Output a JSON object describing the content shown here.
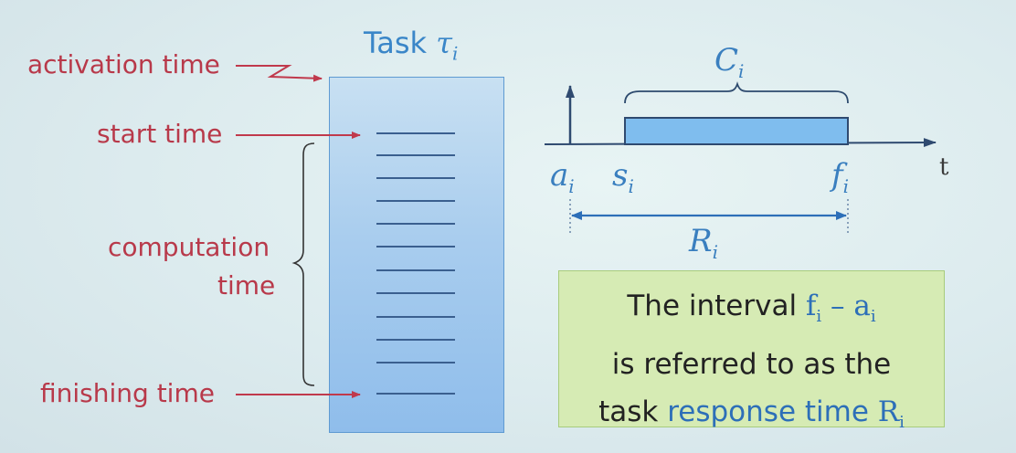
{
  "labels": {
    "activation": "activation time",
    "start": "start time",
    "computation_line1": "computation",
    "computation_line2": "time",
    "finishing": "finishing time"
  },
  "task": {
    "title_word": "Task",
    "symbol": "τ",
    "subscript": "i"
  },
  "timeline": {
    "axis_label": "t",
    "a": {
      "symbol": "a",
      "subscript": "i"
    },
    "s": {
      "symbol": "s",
      "subscript": "i"
    },
    "f": {
      "symbol": "f",
      "subscript": "i"
    },
    "C": {
      "symbol": "C",
      "subscript": "i"
    },
    "R": {
      "symbol": "R",
      "subscript": "i"
    }
  },
  "note": {
    "line1_prefix": "The interval ",
    "f_symbol": "f",
    "f_sub": "i",
    "minus": " – ",
    "a_symbol": "a",
    "a_sub": "i",
    "line2": "is referred to as the",
    "line3_prefix": "task ",
    "line3_blue": "response time ",
    "R_symbol": "R",
    "R_sub": "i"
  },
  "colors": {
    "label_red": "#b8394a",
    "task_blue": "#3a86c8",
    "math_blue": "#3a7fbf",
    "bar_fill": "#7fbdee",
    "note_bg": "#d6ebb4"
  }
}
